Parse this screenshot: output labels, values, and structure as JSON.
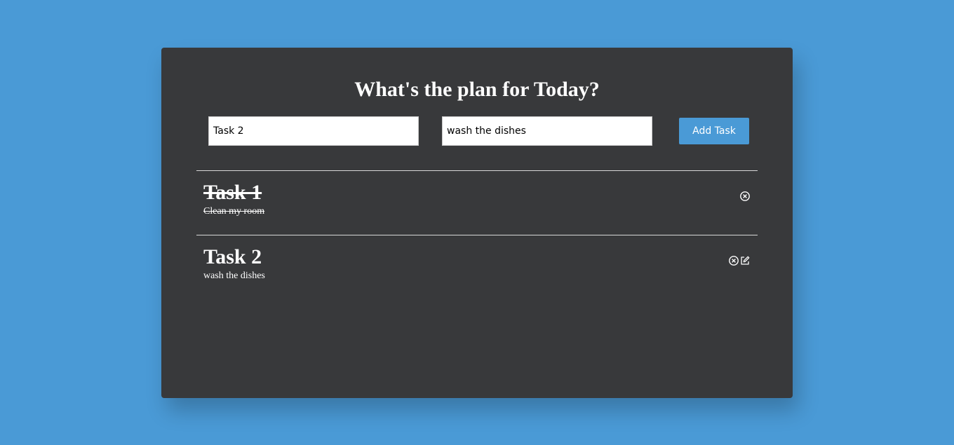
{
  "header": {
    "title": "What's the plan for Today?"
  },
  "form": {
    "title_input_value": "Task 2",
    "description_input_value": "wash the dishes",
    "add_button_label": "Add Task"
  },
  "tasks": [
    {
      "title": "Task 1",
      "description": "Clean my room",
      "completed": true,
      "actions": [
        "delete-icon"
      ]
    },
    {
      "title": "Task 2",
      "description": "wash the dishes",
      "completed": false,
      "actions": [
        "delete-icon",
        "edit-icon"
      ]
    }
  ],
  "colors": {
    "background": "#4a9ad6",
    "panel": "#38393b",
    "accent": "#4a9ad6",
    "text": "#ffffff"
  }
}
